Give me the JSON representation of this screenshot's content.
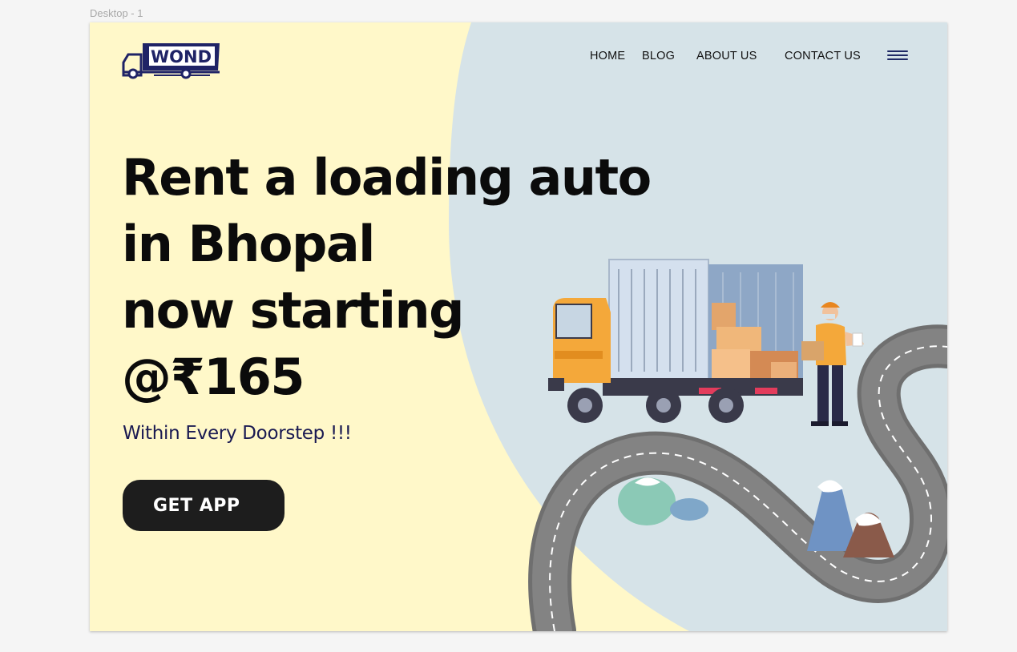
{
  "frame": {
    "label": "Desktop - 1"
  },
  "brand": {
    "logo_text": "WOND"
  },
  "nav": {
    "items": [
      {
        "label": "HOME"
      },
      {
        "label": "BLOG"
      },
      {
        "label": "ABOUT US"
      },
      {
        "label": "CONTACT US"
      }
    ],
    "menu_icon": "hamburger-menu-icon"
  },
  "hero": {
    "headline_lines": [
      "Rent a loading auto",
      "in Bhopal",
      "now starting",
      "@₹165"
    ],
    "tagline": "Within Every Doorstep !!!",
    "cta_label": "GET APP"
  },
  "colors": {
    "background_yellow": "#fff8c9",
    "background_blue": "#d6e3e8",
    "text_dark": "#0b0b0b",
    "tagline_navy": "#1a1a52",
    "button_dark": "#1d1d1d",
    "truck_orange": "#f4a83a",
    "road_gray": "#7a7a7a"
  }
}
